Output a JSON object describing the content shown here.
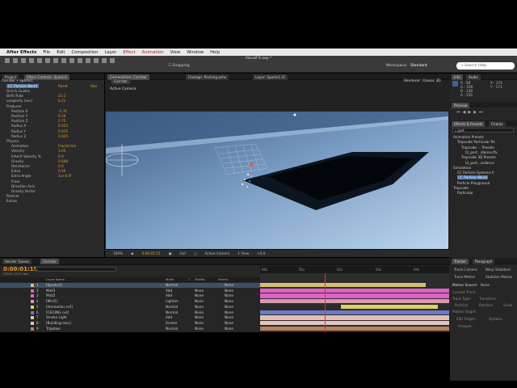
{
  "menubar": {
    "app": "After Effects",
    "items": [
      "File",
      "Edit",
      "Composition",
      "Layer",
      "Effect",
      "Animation",
      "View",
      "Window",
      "Help"
    ],
    "highlighted": [
      "Effect",
      "Animation"
    ]
  },
  "toolbar": {
    "window_title": "VisualFX.aep *",
    "snapping": "Snapping",
    "workspace_label": "Workspace:",
    "workspace_value": "Standard",
    "search_placeholder": "Search Help"
  },
  "project_panel": {
    "tabs": [
      "Project",
      "Effect Controls: Sparks1"
    ],
    "path": "Corridor • Sparks1",
    "effect_name": "CC Particle World",
    "reset": "Reset",
    "about": "Abo",
    "rows": [
      {
        "label": "Grid & Guides",
        "value": ""
      },
      {
        "label": "Birth Rate",
        "value": "23.1"
      },
      {
        "label": "Longevity (sec)",
        "value": "0.21"
      },
      {
        "label": "Producer",
        "value": ""
      },
      {
        "label": "Position X",
        "value": "-1.76"
      },
      {
        "label": "Position Y",
        "value": "0.10"
      },
      {
        "label": "Position Z",
        "value": "2.75"
      },
      {
        "label": "Radius X",
        "value": "0.025"
      },
      {
        "label": "Radius Y",
        "value": "0.025"
      },
      {
        "label": "Radius Z",
        "value": "0.025"
      },
      {
        "label": "Physics",
        "value": ""
      },
      {
        "label": "Animation",
        "value": "Fractal Uni"
      },
      {
        "label": "Velocity",
        "value": "3.05"
      },
      {
        "label": "Inherit Velocity %",
        "value": "0.0"
      },
      {
        "label": "Gravity",
        "value": "0.698"
      },
      {
        "label": "Resistance",
        "value": "0.0"
      },
      {
        "label": "Extra",
        "value": "0.50"
      },
      {
        "label": "Extra Angle",
        "value": "1x+0.0°"
      },
      {
        "label": "Floor",
        "value": ""
      },
      {
        "label": "Direction Axis",
        "value": ""
      },
      {
        "label": "Gravity Vector",
        "value": ""
      },
      {
        "label": "Particle",
        "value": ""
      },
      {
        "label": "Extras",
        "value": ""
      }
    ]
  },
  "composition": {
    "tabs": [
      "Composition: Corridor",
      "Footage: flashing.wmv",
      "Layer: Sparks1.2f"
    ],
    "comp_tab": "Corridor",
    "camera_label": "Active Camera",
    "renderer_label": "Renderer:",
    "renderer_value": "Classic 3D",
    "viewer_controls": [
      "100%",
      "0:00:01:15",
      "Full",
      "Active Camera",
      "1 View",
      "+0.0"
    ]
  },
  "timeline": {
    "tabs": [
      "Render Queue",
      "Corridor"
    ],
    "timecode": "0:00:01:15",
    "frame_info": "00040 (25.00 fps)",
    "headers": [
      "Layer Name",
      "Mode",
      "T",
      "TrkMat",
      "Parent"
    ],
    "ruler": [
      "00s",
      "01s",
      "02s",
      "03s",
      "04s"
    ],
    "layers": [
      {
        "num": "1",
        "name": "[Sparks1]",
        "mode": "Normal",
        "trkmat": "",
        "parent": "None",
        "color": "#d4c26a"
      },
      {
        "num": "2",
        "name": "Mist3",
        "mode": "Add",
        "trkmat": "None",
        "parent": "None",
        "color": "#e062c8"
      },
      {
        "num": "3",
        "name": "Mist2",
        "mode": "Add",
        "trkmat": "None",
        "parent": "None",
        "color": "#e062c8"
      },
      {
        "num": "4",
        "name": "[Mist1]",
        "mode": "Lighten",
        "trkmat": "None",
        "parent": "None",
        "color": "#d79ab0"
      },
      {
        "num": "5",
        "name": "[Animation.rvd]",
        "mode": "Normal",
        "trkmat": "None",
        "parent": "None",
        "color": "#e0d060"
      },
      {
        "num": "6",
        "name": "[CEILING.rvd]",
        "mode": "Normal",
        "trkmat": "None",
        "parent": "None",
        "color": "#6d79c9"
      },
      {
        "num": "7",
        "name": "Smoke Light",
        "mode": "Add",
        "trkmat": "None",
        "parent": "None",
        "color": "#e0c1b4"
      },
      {
        "num": "8",
        "name": "[Building.mov]",
        "mode": "Screen",
        "trkmat": "None",
        "parent": "None",
        "color": "#e2c5bd"
      },
      {
        "num": "9",
        "name": "Tripolaer",
        "mode": "Normal",
        "trkmat": "None",
        "parent": "None",
        "color": "#b98060"
      }
    ]
  },
  "info_panel": {
    "tabs": [
      "Info",
      "Audio"
    ],
    "r": "R : 58",
    "g": "G : 100",
    "b": "B : 149",
    "a": "A : 255",
    "x": "X : 374",
    "y": "Y : 173"
  },
  "preview_panel": {
    "tab": "Preview"
  },
  "effects_panel": {
    "tabs": [
      "Effects & Presets",
      "Charac"
    ],
    "search": "part",
    "tree": [
      {
        "label": "Animation Presets",
        "level": 0,
        "sel": false
      },
      {
        "label": "Trapcode Particular ffx",
        "level": 1,
        "sel": false
      },
      {
        "label": "Trapcode ... Presets",
        "level": 2,
        "sel": false
      },
      {
        "label": "t2_part...diance.ffx",
        "level": 3,
        "sel": false
      },
      {
        "label": "Trapcode 3D Presets",
        "level": 2,
        "sel": false
      },
      {
        "label": "t3_part...ardance",
        "level": 3,
        "sel": false
      },
      {
        "label": "Simulation",
        "level": 0,
        "sel": false
      },
      {
        "label": "CC Particle Systems II",
        "level": 1,
        "sel": false
      },
      {
        "label": "CC Particle World",
        "level": 1,
        "sel": true
      },
      {
        "label": "Particle Playground",
        "level": 1,
        "sel": false
      },
      {
        "label": "Trapcode",
        "level": 0,
        "sel": false
      },
      {
        "label": "Particular",
        "level": 1,
        "sel": false
      }
    ]
  },
  "tracker_panel": {
    "tabs": [
      "Tracker",
      "Paragraph"
    ],
    "buttons": [
      "Track Camera",
      "Warp Stabilizer",
      "Track Motion",
      "Stabilize Motion"
    ],
    "motion_source_label": "Motion Source:",
    "motion_source_value": "None",
    "current_track": "Current Track:",
    "track_type": "Track Type:",
    "track_type_value": "Transform",
    "checks": [
      "Position",
      "Rotation",
      "Scale"
    ],
    "motion_target": "Motion Target:",
    "edit_target": "Edit Target...",
    "options": "Options...",
    "analyze": "Analyze:"
  }
}
